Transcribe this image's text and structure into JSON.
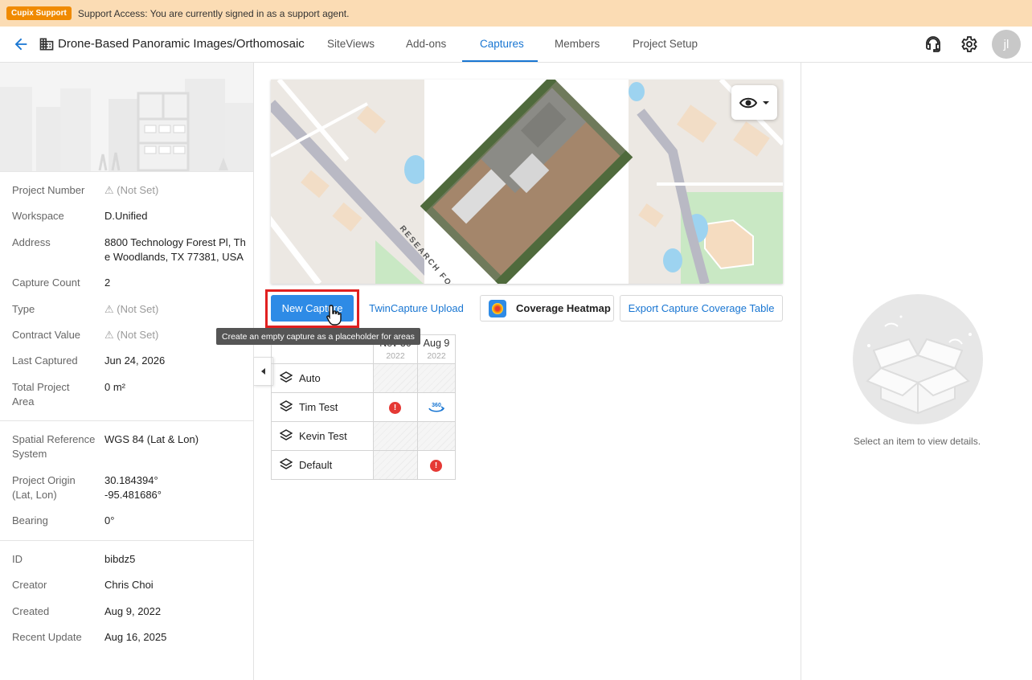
{
  "banner": {
    "badge": "Cupix Support",
    "text": "Support Access: You are currently signed in as a support agent."
  },
  "header": {
    "project_title": "Drone-Based Panoramic Images/Orthomosaic",
    "tabs": [
      {
        "label": "SiteViews"
      },
      {
        "label": "Add-ons"
      },
      {
        "label": "Captures",
        "active": true
      },
      {
        "label": "Members"
      },
      {
        "label": "Project Setup"
      }
    ],
    "avatar_initials": "jl"
  },
  "details": {
    "group1": [
      {
        "label": "Project Number",
        "value": "⚠ (Not Set)",
        "not_set": true
      },
      {
        "label": "Workspace",
        "value": "D.Unified"
      },
      {
        "label": "Address",
        "value": "8800 Technology Forest Pl, The Woodlands, TX 77381, USA"
      },
      {
        "label": "Capture Count",
        "value": "2"
      },
      {
        "label": "Type",
        "value": "⚠ (Not Set)",
        "not_set": true
      },
      {
        "label": "Contract Value",
        "value": "⚠ (Not Set)",
        "not_set": true
      },
      {
        "label": "Last Captured",
        "value": "Jun 24, 2026"
      },
      {
        "label": "Total Project Area",
        "value": "0 m²"
      }
    ],
    "group2": [
      {
        "label": "Spatial Reference System",
        "value": "WGS 84 (Lat & Lon)"
      },
      {
        "label": "Project Origin (Lat, Lon)",
        "value": "30.184394°",
        "value2": "-95.481686°"
      },
      {
        "label": "Bearing",
        "value": "0°"
      }
    ],
    "group3": [
      {
        "label": "ID",
        "value": "bibdz5"
      },
      {
        "label": "Creator",
        "value": "Chris Choi"
      },
      {
        "label": "Created",
        "value": "Aug 9, 2022"
      },
      {
        "label": "Recent Update",
        "value": "Aug 16, 2025"
      }
    ]
  },
  "map": {
    "street_label": "RESEARCH FOR"
  },
  "actions": {
    "new_capture": "New Capture",
    "twin_upload": "TwinCapture Upload",
    "heatmap": "Coverage Heatmap",
    "export": "Export Capture Coverage Table",
    "tooltip": "Create an empty capture as a placeholder for areas"
  },
  "captures": {
    "columns": [
      {
        "date": "Nov 30",
        "year": "2022"
      },
      {
        "date": "Aug 9",
        "year": "2022"
      }
    ],
    "rows": [
      {
        "name": "Auto",
        "cells": [
          "empty",
          "empty"
        ]
      },
      {
        "name": "Tim Test",
        "cells": [
          "error",
          "360"
        ]
      },
      {
        "name": "Kevin Test",
        "cells": [
          "empty",
          "empty"
        ]
      },
      {
        "name": "Default",
        "cells": [
          "empty",
          "error"
        ]
      }
    ],
    "error_glyph": "!",
    "pano_label": "360"
  },
  "right_panel": {
    "empty_text": "Select an item to view details."
  },
  "colors": {
    "accent": "#1976d2",
    "primary_button": "#2e8be6",
    "banner": "#fbdcb4",
    "badge": "#f08a00",
    "error": "#e53935",
    "highlight": "#e02020"
  }
}
